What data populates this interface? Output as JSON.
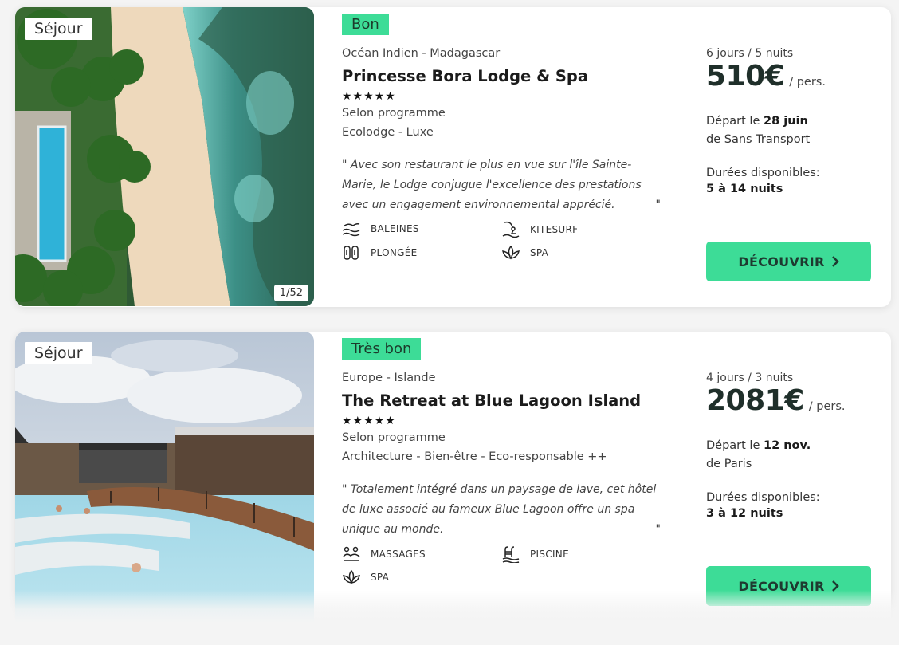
{
  "cards": [
    {
      "tag": "Séjour",
      "photo_counter": "1/52",
      "rating": "Bon",
      "destination": "Océan Indien - Madagascar",
      "name": "Princesse Bora Lodge & Spa",
      "stars": 5,
      "stars_text": "★★★★★",
      "plan": "Selon programme",
      "style": "Ecolodge - Luxe",
      "quote": "\" Avec son restaurant le plus en vue sur l'île Sainte-Marie, le Lodge conjugue l'excellence des prestations avec un engagement environnemental apprécié.",
      "quote_close": "\"",
      "amenities": [
        {
          "label": "BALEINES",
          "icon": "whale-icon"
        },
        {
          "label": "KITESURF",
          "icon": "kitesurf-icon"
        },
        {
          "label": "PLONGÉE",
          "icon": "diving-icon"
        },
        {
          "label": "SPA",
          "icon": "spa-icon"
        }
      ],
      "duration": "6 jours / 5 nuits",
      "price": "510€",
      "price_suffix": "/ pers.",
      "depart_prefix": "Départ le",
      "depart_date": "28 juin",
      "depart_from": "de Sans Transport",
      "durations_label": "Durées disponibles:",
      "durations_value": "5 à 14 nuits",
      "cta": "DÉCOUVRIR",
      "cta_icon": "chevron-right-icon"
    },
    {
      "tag": "Séjour",
      "rating": "Très bon",
      "destination": "Europe - Islande",
      "name": "The Retreat at Blue Lagoon Island",
      "stars": 5,
      "stars_text": "★★★★★",
      "plan": "Selon programme",
      "style": "Architecture - Bien-être - Eco-responsable ++",
      "quote": "\" Totalement intégré dans un paysage de lave, cet hôtel de luxe associé au fameux Blue Lagoon offre un spa unique au monde.",
      "quote_close": "\"",
      "amenities": [
        {
          "label": "MASSAGES",
          "icon": "massage-icon"
        },
        {
          "label": "PISCINE",
          "icon": "pool-icon"
        },
        {
          "label": "SPA",
          "icon": "spa-icon"
        }
      ],
      "duration": "4 jours / 3 nuits",
      "price": "2081€",
      "price_suffix": "/ pers.",
      "depart_prefix": "Départ le",
      "depart_date": "12 nov.",
      "depart_from": "de Paris",
      "durations_label": "Durées disponibles:",
      "durations_value": "3 à 12 nuits",
      "cta": "DÉCOUVRIR",
      "cta_icon": "chevron-right-icon"
    }
  ],
  "colors": {
    "accent": "#3ddc97",
    "accent_text": "#1e3a30",
    "price_text": "#1f2f2a"
  }
}
